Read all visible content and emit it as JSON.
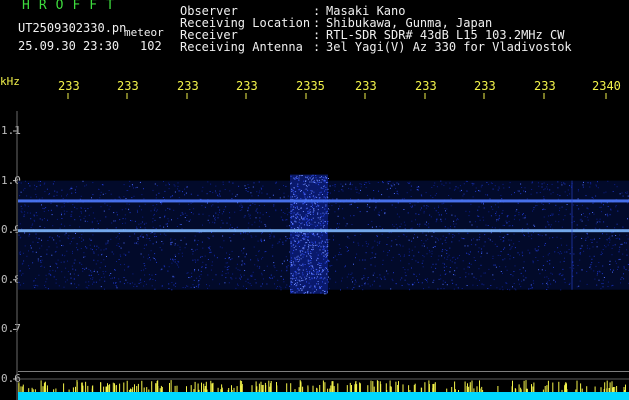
{
  "header": {
    "logo": "HROFFT",
    "filename": "UT2509302330.pn",
    "meteor_tag": "meteor",
    "timestamp": "25.09.30 23:30",
    "count": "102"
  },
  "info": [
    {
      "label": "Observer",
      "value": "Masaki Kano"
    },
    {
      "label": "Receiving Location",
      "value": "Shibukawa, Gunma, Japan"
    },
    {
      "label": "Receiver",
      "value": "RTL-SDR SDR# 43dB L15 103.2MHz CW"
    },
    {
      "label": "Receiving Antenna",
      "value": "3el Yagi(V) Az 330 for Vladivostok"
    }
  ],
  "chart_data": {
    "type": "heatmap",
    "ylabel": "kHz",
    "y_ticks": [
      "1.1",
      "1.0",
      "0.9",
      "0.8",
      "0.7",
      "0.6"
    ],
    "x_ticks": [
      "233",
      "233",
      "233",
      "233",
      "2335",
      "233",
      "233",
      "233",
      "233",
      "2340"
    ],
    "ylim": [
      0.6,
      1.15
    ],
    "band_kHz": [
      0.78,
      1.0
    ],
    "carrier_lines_kHz": [
      0.96,
      0.9
    ],
    "burst_x_tick_index": 4,
    "colors": {
      "background": "#000000",
      "noise": "#1a3cff",
      "signal": "#8ecfff",
      "bottom_bar": "#00d8ff",
      "bottom_bar_noise": "#f2f24a"
    }
  }
}
